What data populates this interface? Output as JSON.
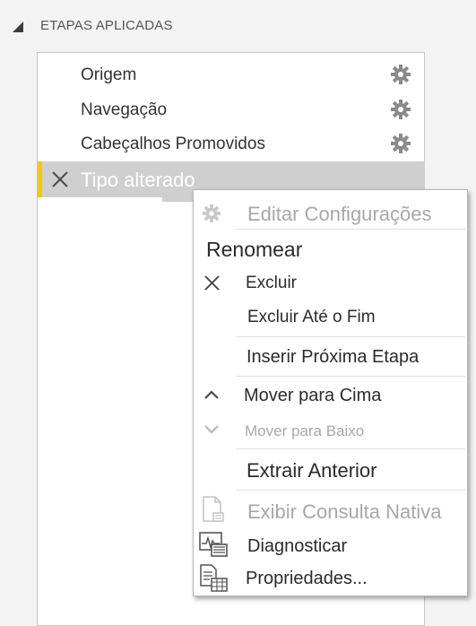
{
  "section": {
    "title": "ETAPAS APLICADAS"
  },
  "steps": [
    {
      "label": "Origem",
      "icon": "gear-icon"
    },
    {
      "label": "Navegação",
      "icon": "gear-icon"
    },
    {
      "label": "Cabeçalhos Promovidos",
      "icon": "gear-icon"
    },
    {
      "label": "Tipo alterado",
      "icon": "close-icon",
      "selected": true
    }
  ],
  "context_menu": {
    "items": [
      {
        "label": "Editar Configurações",
        "disabled": true,
        "icon": "gear-icon"
      },
      {
        "label": "Renomear"
      },
      {
        "label": "Excluir",
        "icon": "close-icon"
      },
      {
        "label": "Excluir Até o Fim"
      },
      {
        "label": "Inserir Próxima Etapa"
      },
      {
        "label": "Mover para Cima",
        "icon": "chevron-up-icon"
      },
      {
        "label": "Mover para Baixo",
        "disabled": true,
        "icon": "chevron-down-icon"
      },
      {
        "label": "Extrair Anterior"
      },
      {
        "label": "Exibir Consulta Nativa",
        "disabled": true,
        "icon": "document-icon"
      },
      {
        "label": "Diagnosticar",
        "icon": "diagnostics-icon"
      },
      {
        "label": "Propriedades...",
        "icon": "properties-icon"
      }
    ]
  },
  "colors": {
    "accent": "#f2c811",
    "selected_row": "#cfcfcf",
    "disabled_text": "#a8a8a8"
  }
}
